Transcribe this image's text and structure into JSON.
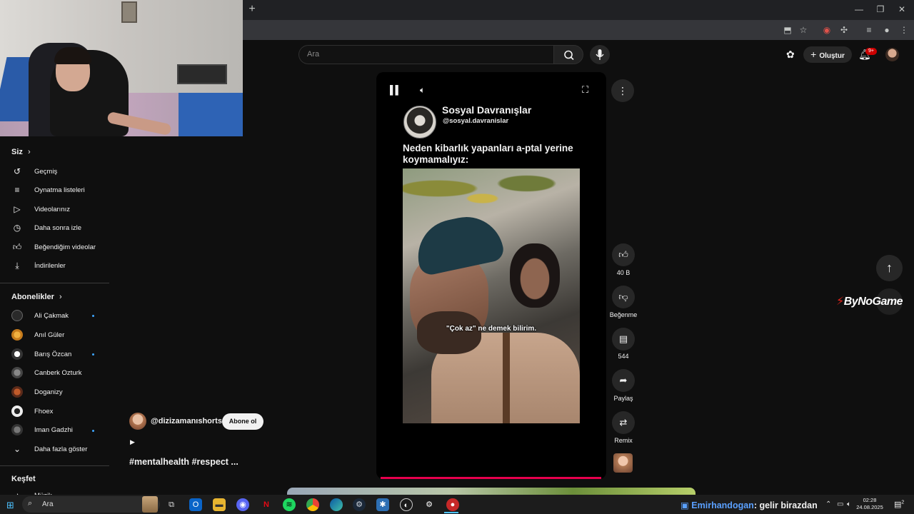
{
  "browser": {
    "new_tab_glyph": "+",
    "window_controls": [
      "—",
      "❐",
      "✕"
    ]
  },
  "header": {
    "search_placeholder": "Ara",
    "create_label": "Oluştur",
    "notification_count": "9+"
  },
  "sidebar": {
    "you_heading": "Siz",
    "you_items": [
      {
        "label": "Geçmiş",
        "icon": "history-icon"
      },
      {
        "label": "Oynatma listeleri",
        "icon": "playlist-icon"
      },
      {
        "label": "Videolarınız",
        "icon": "your-videos-icon"
      },
      {
        "label": "Daha sonra izle",
        "icon": "watch-later-icon"
      },
      {
        "label": "Beğendiğim videolar",
        "icon": "liked-icon"
      },
      {
        "label": "İndirilenler",
        "icon": "download-icon"
      }
    ],
    "subs_heading": "Abonelikler",
    "subscriptions": [
      {
        "label": "Ali Çakmak",
        "new": true
      },
      {
        "label": "Anıl Güler",
        "new": false
      },
      {
        "label": "Barış Özcan",
        "new": true
      },
      {
        "label": "Canberk Ozturk",
        "new": false
      },
      {
        "label": "Doganizy",
        "new": false
      },
      {
        "label": "Fhoex",
        "new": false
      },
      {
        "label": "Iman Gadzhi",
        "new": true
      }
    ],
    "show_more": "Daha fazla göster",
    "explore_heading": "Keşfet",
    "explore_first": "Müzik"
  },
  "short": {
    "channel_handle": "@dizizamanıshorts",
    "subscribe_label": "Abone ol",
    "tags": "#mentalhealth #respect ...",
    "overlay_name": "Sosyal Davranışlar",
    "overlay_handle": "@sosyal.davranislar",
    "question": "Neden kibarlık yapanları a-ptal yerine koymamalıyız:",
    "subtitle": "\"Çok az\" ne demek bilirim.",
    "progress": 0.96
  },
  "actions": {
    "likes": "40 B",
    "dislike": "Beğenme",
    "comments": "544",
    "share": "Paylaş",
    "remix": "Remix"
  },
  "watermark": {
    "brand_a": "By",
    "brand_b": "NoGame"
  },
  "taskbar": {
    "search_label": "Ara",
    "chat_user": "Emirhandogan",
    "chat_text": ": gelir birazdan",
    "time": "02:28",
    "date": "24.08.2025",
    "notif_count": "2"
  },
  "colors": {
    "accent": "#3ea6ff",
    "progress": "#e6004d",
    "badge": "#cc0000"
  }
}
